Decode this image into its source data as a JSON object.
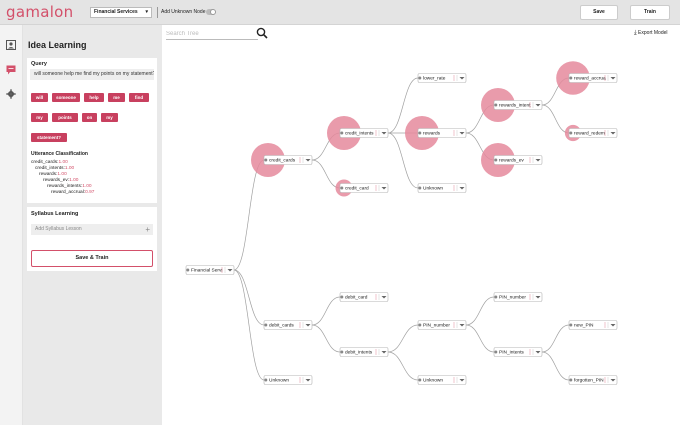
{
  "app": {
    "logo": "gamalon",
    "dataset_select": "Financial Services",
    "add_unknown_label": "Add Unknown Node",
    "save_label": "Save",
    "train_label": "Train"
  },
  "panel": {
    "title": "Idea Learning",
    "query_heading": "Query",
    "query_text": "will someone help me find my points on my statement?",
    "chips": [
      "will",
      "someone",
      "help",
      "me",
      "find",
      "my",
      "points",
      "on",
      "my",
      "statement?"
    ],
    "utterance_heading": "Utterance Classification",
    "utterances": [
      {
        "label": "credit_cards:",
        "value": "1.00"
      },
      {
        "label": "credit_intents:",
        "value": "1.00"
      },
      {
        "label": "rewards:",
        "value": "1.00"
      },
      {
        "label": "rewards_ev:",
        "value": "1.00"
      },
      {
        "label": "rewards_intents:",
        "value": "1.00"
      },
      {
        "label": "reward_accrual:",
        "value": "0.97"
      }
    ],
    "syllabus_heading": "Syllabus Learning",
    "syllabus_placeholder": "Add Syllabus Lesson",
    "save_train_label": "Save & Train"
  },
  "main": {
    "search_placeholder": "Search Tree",
    "export_label": "Export Model"
  },
  "colors": {
    "accent": "#d3506a",
    "chip": "#c8405f",
    "bubble": "#e58a9c",
    "edge": "#a0a0a0"
  },
  "tree": {
    "nodes": [
      {
        "id": "root",
        "label": "Financial Servi",
        "weight": 0
      },
      {
        "id": "credit_cards",
        "label": "credit_cards",
        "weight": 1.0
      },
      {
        "id": "debit_cards",
        "label": "debit_cards",
        "weight": 0
      },
      {
        "id": "unk_l1",
        "label": "Unknown",
        "weight": 0
      },
      {
        "id": "credit_intents",
        "label": "credit_intents",
        "weight": 1.0
      },
      {
        "id": "credit_card",
        "label": "credit_card",
        "weight": 0.12
      },
      {
        "id": "lower_rate",
        "label": "lower_rate",
        "weight": 0
      },
      {
        "id": "rewards",
        "label": "rewards",
        "weight": 1.0
      },
      {
        "id": "unk_ci",
        "label": "Unknown",
        "weight": 0
      },
      {
        "id": "rewards_intent",
        "label": "rewards_intent",
        "weight": 1.0
      },
      {
        "id": "rewards_ev",
        "label": "rewards_ev",
        "weight": 1.0
      },
      {
        "id": "reward_accrua",
        "label": "reward_accrua",
        "weight": 0.97
      },
      {
        "id": "reward_redem",
        "label": "reward_redem",
        "weight": 0.1
      },
      {
        "id": "debit_card",
        "label": "debit_card",
        "weight": 0
      },
      {
        "id": "debit_intents",
        "label": "debit_intents",
        "weight": 0
      },
      {
        "id": "PIN_number_i",
        "label": "PIN_number",
        "weight": 0
      },
      {
        "id": "unk_di",
        "label": "Unknown",
        "weight": 0
      },
      {
        "id": "PIN_number_leaf",
        "label": "PIN_number",
        "weight": 0
      },
      {
        "id": "PIN_intents",
        "label": "PIN_intents",
        "weight": 0
      },
      {
        "id": "new_PIN",
        "label": "new_PIN",
        "weight": 0
      },
      {
        "id": "forgotten_PIN",
        "label": "forgotten_PIN",
        "weight": 0
      }
    ],
    "edges": [
      [
        "root",
        "credit_cards"
      ],
      [
        "root",
        "debit_cards"
      ],
      [
        "root",
        "unk_l1"
      ],
      [
        "credit_cards",
        "credit_intents"
      ],
      [
        "credit_cards",
        "credit_card"
      ],
      [
        "credit_intents",
        "lower_rate"
      ],
      [
        "credit_intents",
        "rewards"
      ],
      [
        "credit_intents",
        "unk_ci"
      ],
      [
        "rewards",
        "rewards_intent"
      ],
      [
        "rewards",
        "rewards_ev"
      ],
      [
        "rewards_intent",
        "reward_accrua"
      ],
      [
        "rewards_intent",
        "reward_redem"
      ],
      [
        "debit_cards",
        "debit_card"
      ],
      [
        "debit_cards",
        "debit_intents"
      ],
      [
        "debit_intents",
        "PIN_number_i"
      ],
      [
        "debit_intents",
        "unk_di"
      ],
      [
        "PIN_number_i",
        "PIN_number_leaf"
      ],
      [
        "PIN_number_i",
        "PIN_intents"
      ],
      [
        "PIN_intents",
        "new_PIN"
      ],
      [
        "PIN_intents",
        "forgotten_PIN"
      ]
    ]
  }
}
